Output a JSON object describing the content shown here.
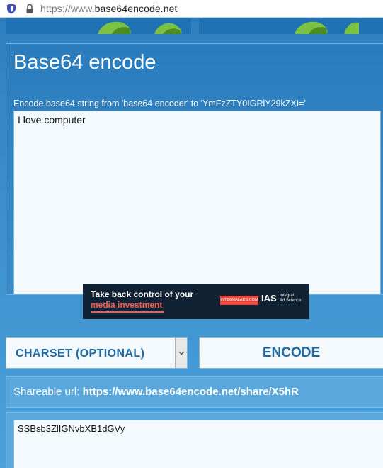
{
  "browser": {
    "url_scheme": "https://www.",
    "url_host": "base64encode.net"
  },
  "header": {
    "title": "Base64 encode",
    "subtitle": "Encode base64 string from 'base64 encoder' to 'YmFzZTY0IGRlY29kZXI='"
  },
  "input": {
    "value": "I love computer"
  },
  "ad": {
    "line1": "Take back control of your",
    "line2": "media investment",
    "button": "INTEGRALADS.COM",
    "logo": "IAS",
    "logo_sub1": "Integral",
    "logo_sub2": "Ad Science"
  },
  "controls": {
    "charset_label": "CHARSET (OPTIONAL)",
    "encode_label": "ENCODE"
  },
  "share": {
    "label": "Shareable url: ",
    "url": "https://www.base64encode.net/share/X5hR"
  },
  "output": {
    "value": "SSBsb3ZlIGNvbXB1dGVy"
  },
  "colors": {
    "page_bg": "#3d8fcb",
    "accent_text": "#1f6aa5",
    "ad_accent": "#ff5a4d"
  }
}
